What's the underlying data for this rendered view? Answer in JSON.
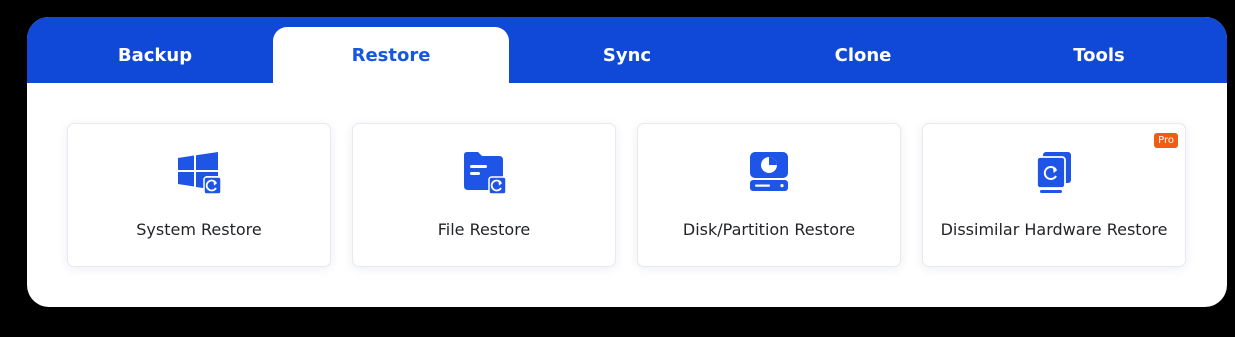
{
  "colors": {
    "tabbar_blue": "#1048d8",
    "active_tab_text": "#1557e0",
    "icon_blue": "#1f55e6",
    "pro_badge": "#f35a12"
  },
  "tabs": [
    {
      "label": "Backup",
      "active": false
    },
    {
      "label": "Restore",
      "active": true
    },
    {
      "label": "Sync",
      "active": false
    },
    {
      "label": "Clone",
      "active": false
    },
    {
      "label": "Tools",
      "active": false
    }
  ],
  "cards": [
    {
      "label": "System Restore",
      "icon": "windows-restore-icon"
    },
    {
      "label": "File Restore",
      "icon": "folder-restore-icon"
    },
    {
      "label": "Disk/Partition Restore",
      "icon": "disk-partition-icon"
    },
    {
      "label": "Dissimilar Hardware Restore",
      "icon": "hardware-restore-icon",
      "badge": "Pro"
    }
  ]
}
